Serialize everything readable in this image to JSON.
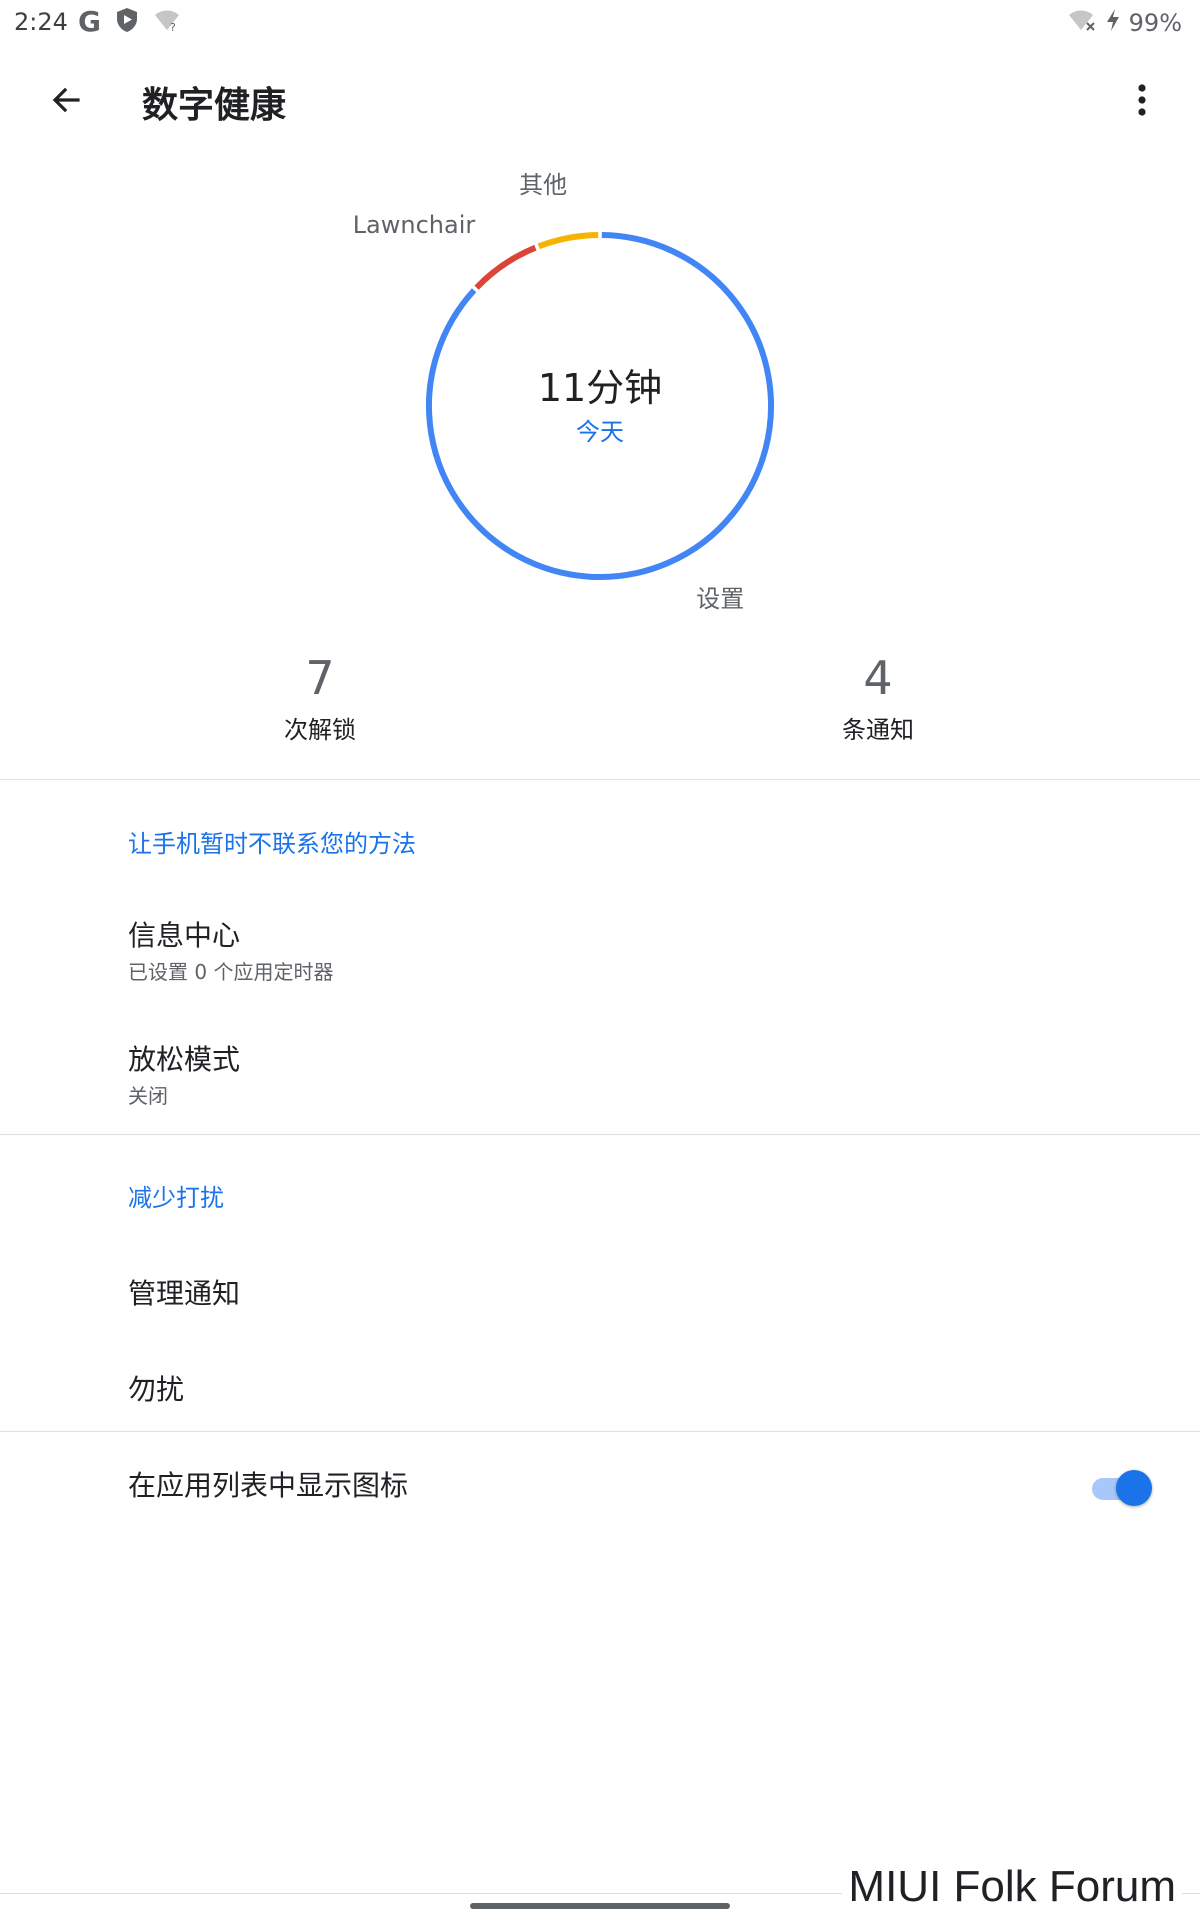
{
  "status_bar": {
    "time": "2:24",
    "battery": "99%",
    "icons_left": [
      "google-icon",
      "shield-icon",
      "wifi-question-icon"
    ],
    "icons_right": [
      "wifi-off-icon",
      "charging-icon"
    ]
  },
  "app_bar": {
    "title": "数字健康",
    "back_icon": "arrow-back-icon",
    "more_icon": "more-vert-icon"
  },
  "chart_data": {
    "type": "pie",
    "categories": [
      "设置",
      "Lawnchair",
      "其他"
    ],
    "values": [
      87,
      7,
      6
    ],
    "colors": [
      "#4285f4",
      "#db4437",
      "#f4b400"
    ],
    "center_value": "11分钟",
    "center_label": "今天"
  },
  "stats": {
    "unlocks": {
      "value": "7",
      "label": "次解锁"
    },
    "notifications": {
      "value": "4",
      "label": "条通知"
    }
  },
  "sections": {
    "disconnect": {
      "header": "让手机暂时不联系您的方法",
      "dashboard": {
        "title": "信息中心",
        "subtitle": "已设置 0 个应用定时器"
      },
      "wind_down": {
        "title": "放松模式",
        "subtitle": "关闭"
      }
    },
    "interruptions": {
      "header": "减少打扰",
      "manage_notifications": {
        "title": "管理通知"
      },
      "dnd": {
        "title": "勿扰"
      }
    },
    "show_icon": {
      "title": "在应用列表中显示图标",
      "toggle_on": true
    }
  },
  "watermark": "MIUI Folk Forum",
  "colors": {
    "accent": "#1a73e8",
    "toggle_track": "#a8c7fa"
  }
}
